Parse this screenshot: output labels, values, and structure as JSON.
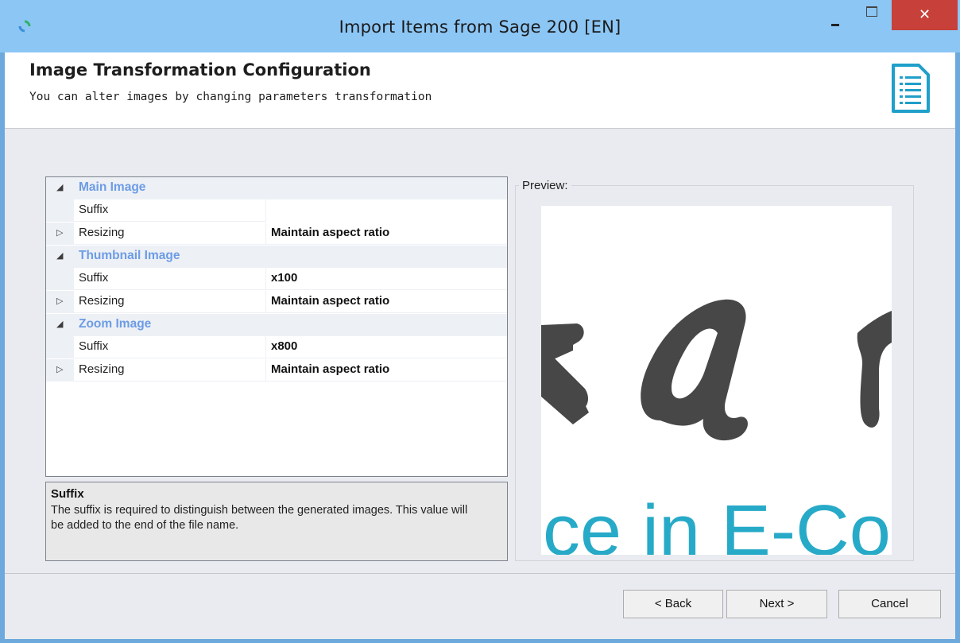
{
  "window": {
    "title": "Import Items from Sage 200 [EN]",
    "close_glyph": "✕"
  },
  "header": {
    "title": "Image Transformation Configuration",
    "subtitle": "You can alter images by changing parameters transformation"
  },
  "property_grid": {
    "sections": [
      {
        "label": "Main Image",
        "rows": [
          {
            "name": "Suffix",
            "value": ""
          },
          {
            "name": "Resizing",
            "value": "Maintain aspect ratio"
          }
        ]
      },
      {
        "label": "Thumbnail Image",
        "rows": [
          {
            "name": "Suffix",
            "value": "x100"
          },
          {
            "name": "Resizing",
            "value": "Maintain aspect ratio"
          }
        ]
      },
      {
        "label": "Zoom Image",
        "rows": [
          {
            "name": "Suffix",
            "value": "x800"
          },
          {
            "name": "Resizing",
            "value": "Maintain aspect ratio"
          }
        ]
      }
    ],
    "expanded_glyph": "◢",
    "collapsed_glyph": "▷"
  },
  "description": {
    "title": "Suffix",
    "text": "The suffix is required to distinguish between the generated images. This value will be added to the end of the file name."
  },
  "preview": {
    "label": "Preview:",
    "image_text": "ce in E-Co"
  },
  "buttons": {
    "back": "< Back",
    "next": "Next >",
    "cancel": "Cancel"
  },
  "colors": {
    "titlebar": "#8cc6f5",
    "close": "#c74039",
    "category_text": "#6c9ce5",
    "preview_logo_dark": "#474747",
    "preview_logo_teal": "#27aac8"
  }
}
